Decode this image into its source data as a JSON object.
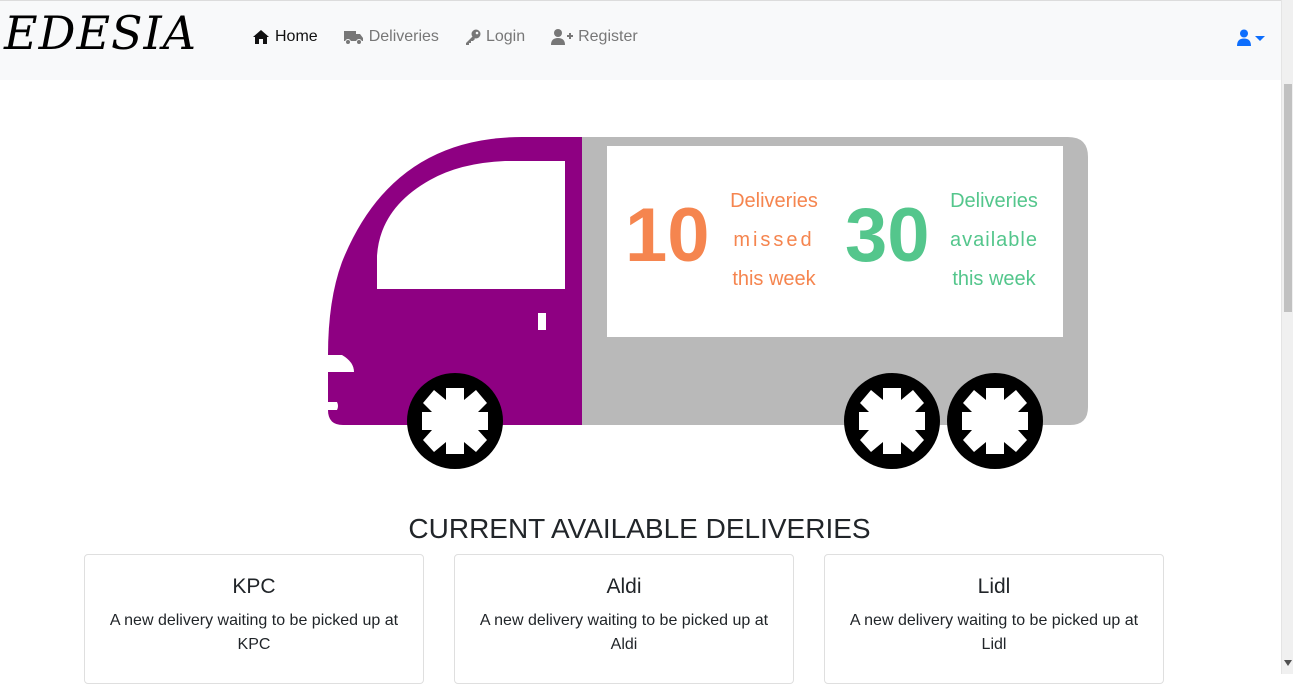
{
  "navbar": {
    "brand": "EDESIA",
    "links": [
      {
        "label": "Home",
        "icon": "home-icon",
        "active": true
      },
      {
        "label": "Deliveries",
        "icon": "truck-icon",
        "active": false
      },
      {
        "label": "Login",
        "icon": "key-icon",
        "active": false
      },
      {
        "label": "Register",
        "icon": "user-plus-icon",
        "active": false
      }
    ],
    "user_menu_icon": "user-icon"
  },
  "hero": {
    "missed": {
      "count": "10",
      "line1": "Deliveries",
      "line2": "missed",
      "line3": "this week",
      "color": "#f5854f"
    },
    "available": {
      "count": "30",
      "line1": "Deliveries",
      "line2": "available",
      "line3": "this week",
      "color": "#54c68c"
    },
    "truck_cab_color": "#8e0082",
    "truck_body_color": "#b9b9b9"
  },
  "section_title": "CURRENT AVAILABLE DELIVERIES",
  "cards": [
    {
      "title": "KPC",
      "text": "A new delivery waiting to be picked up at KPC"
    },
    {
      "title": "Aldi",
      "text": "A new delivery waiting to be picked up at Aldi"
    },
    {
      "title": "Lidl",
      "text": "A new delivery waiting to be picked up at Lidl"
    }
  ],
  "colors": {
    "accent_blue": "#0d6efd",
    "navbar_bg": "#f8f9fa"
  }
}
